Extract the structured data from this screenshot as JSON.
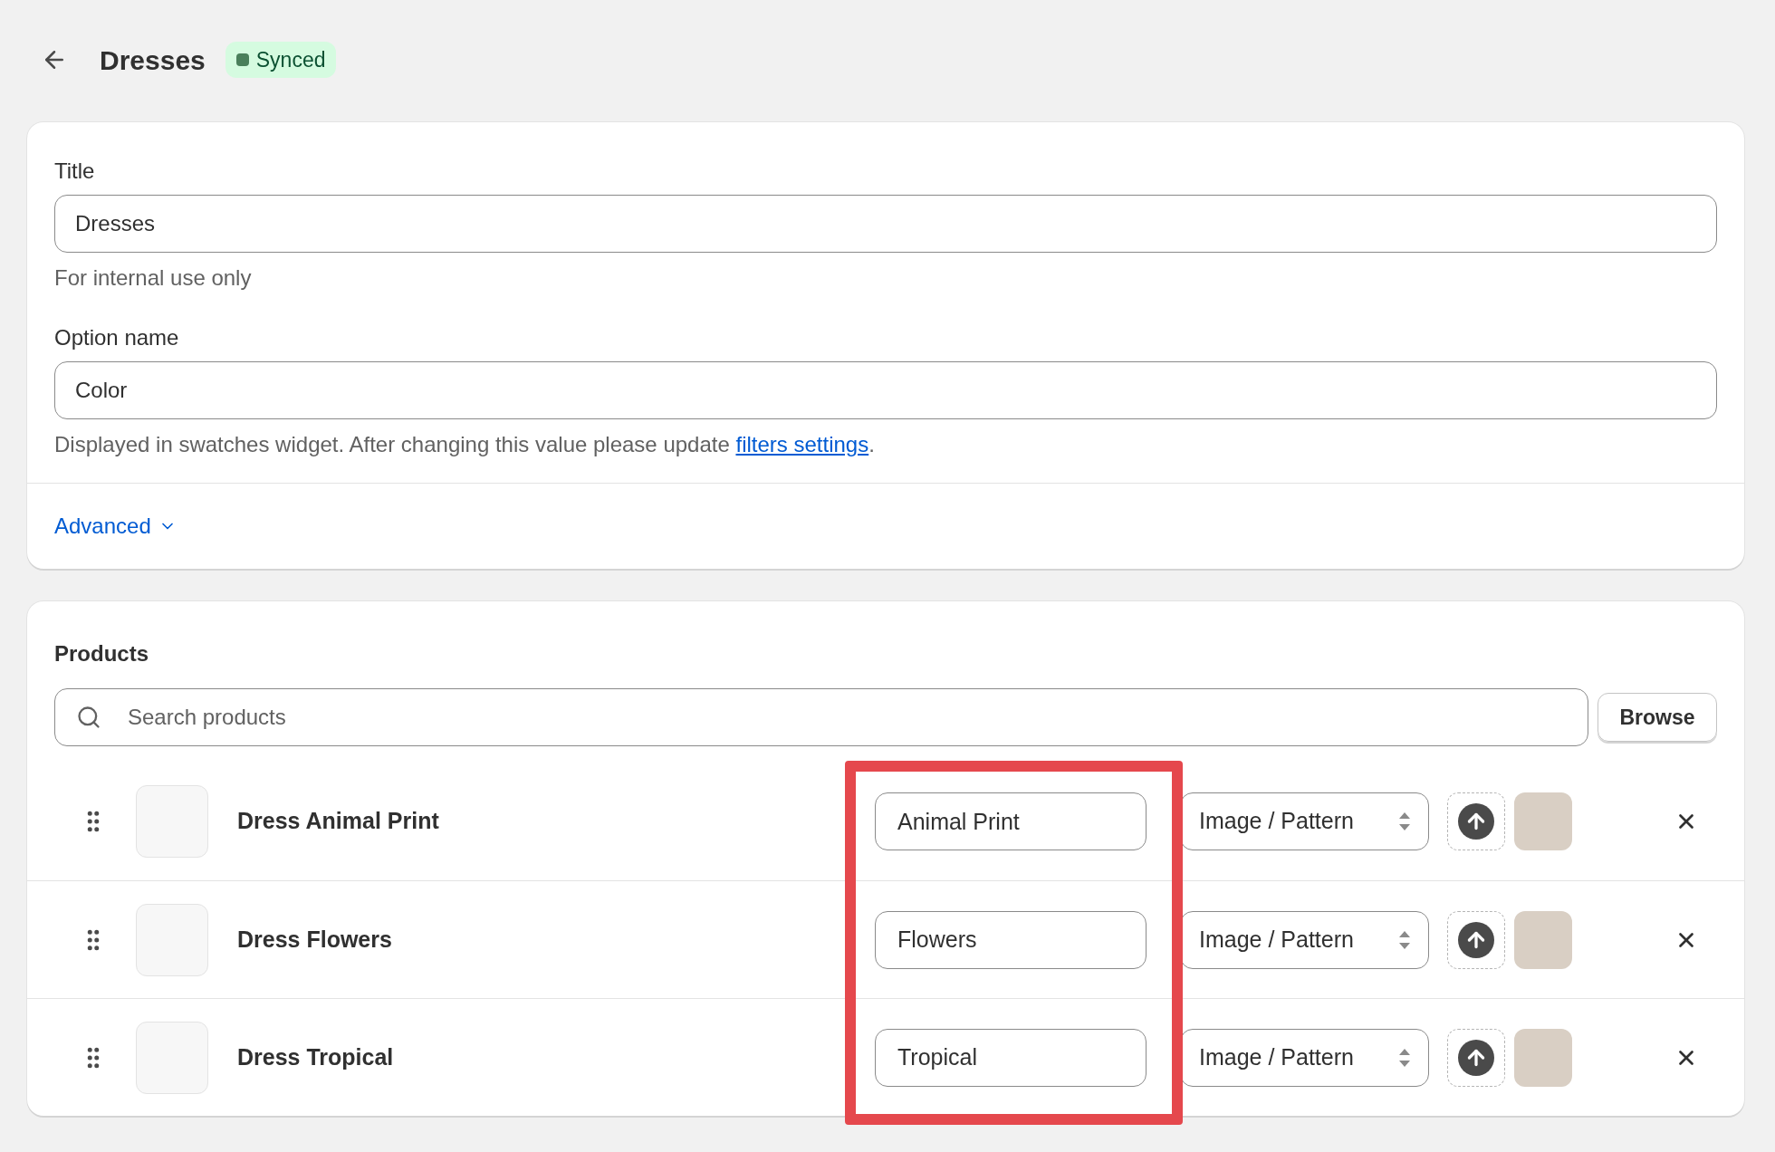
{
  "header": {
    "title": "Dresses",
    "badge": "Synced"
  },
  "settings": {
    "title_label": "Title",
    "title_value": "Dresses",
    "title_help": "For internal use only",
    "option_label": "Option name",
    "option_value": "Color",
    "option_help": "Displayed in swatches widget. After changing this value please update ",
    "option_help_link": "filters settings",
    "option_help_end": ".",
    "advanced": "Advanced",
    "advanced_expanded": false
  },
  "products": {
    "heading": "Products",
    "search": {
      "placeholder": "Search products"
    },
    "browse": "Browse",
    "rows": [
      {
        "name": "Dress Animal Print",
        "value": "Animal Print",
        "type": "Image / Pattern"
      },
      {
        "name": "Dress Flowers",
        "value": "Flowers",
        "type": "Image / Pattern"
      },
      {
        "name": "Dress Tropical",
        "value": "Tropical",
        "type": "Image / Pattern"
      }
    ]
  }
}
